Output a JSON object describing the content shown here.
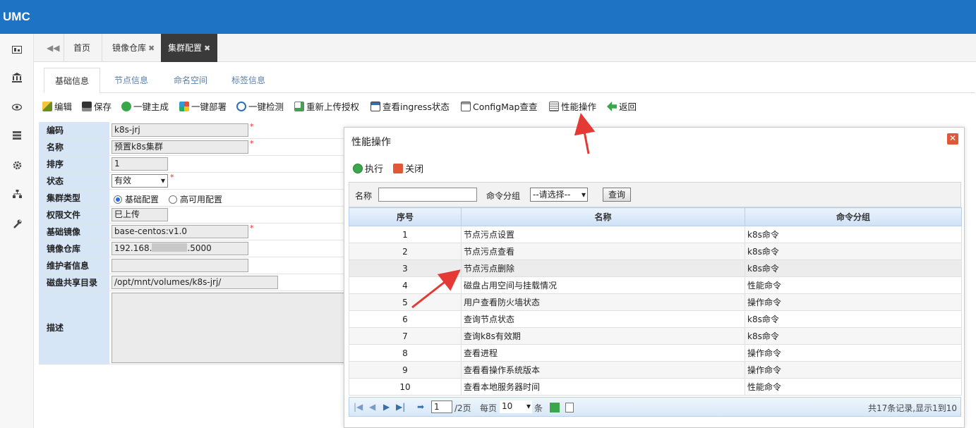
{
  "app": {
    "logo": "UMC"
  },
  "tabs": {
    "home": "首页",
    "image_repo": "镜像仓库",
    "cluster_config": "集群配置",
    "close_glyph": "✖"
  },
  "subtabs": [
    "基础信息",
    "节点信息",
    "命名空间",
    "标签信息"
  ],
  "toolbar": {
    "edit": "编辑",
    "save": "保存",
    "generate": "一键主成",
    "deploy": "一键部署",
    "check": "一键检测",
    "reupload": "重新上传授权",
    "ingress": "查看ingress状态",
    "configmap": "ConfigMap查查",
    "perf": "性能操作",
    "back": "返回"
  },
  "form": {
    "code_label": "编码",
    "code_value": "k8s-jrj",
    "name_label": "名称",
    "name_value": "预置k8s集群",
    "order_label": "排序",
    "order_value": "1",
    "status_label": "状态",
    "status_value": "有效",
    "type_label": "集群类型",
    "type_opt1": "基础配置",
    "type_opt2": "高可用配置",
    "perm_label": "权限文件",
    "perm_value": "巳上传",
    "base_image_label": "基础镜像",
    "base_image_value": "base-centos:v1.0",
    "repo_label": "镜像仓库",
    "repo_value_a": "192.168.",
    "repo_value_b": ".5000",
    "maint_label": "维护者信息",
    "maint_value": "",
    "disk_label": "磁盘共享目录",
    "disk_value": "/opt/mnt/volumes/k8s-jrj/",
    "desc_label": "描述",
    "required_mark": "*"
  },
  "dialog": {
    "title": "性能操作",
    "close": "✕",
    "execute": "执行",
    "close_btn": "关闭",
    "search": {
      "name_label": "名称",
      "name_value": "",
      "group_label": "命令分组",
      "group_value": "--请选择--",
      "query": "查询"
    },
    "columns": [
      "序号",
      "名称",
      "命令分组"
    ],
    "rows": [
      {
        "no": "1",
        "name": "节点污点设置",
        "group": "k8s命令"
      },
      {
        "no": "2",
        "name": "节点污点查看",
        "group": "k8s命令"
      },
      {
        "no": "3",
        "name": "节点污点删除",
        "group": "k8s命令"
      },
      {
        "no": "4",
        "name": "磁盘占用空间与挂载情况",
        "group": "性能命令"
      },
      {
        "no": "5",
        "name": "用户查看防火墙状态",
        "group": "操作命令"
      },
      {
        "no": "6",
        "name": "查询节点状态",
        "group": "k8s命令"
      },
      {
        "no": "7",
        "name": "查询k8s有效期",
        "group": "k8s命令"
      },
      {
        "no": "8",
        "name": "查看进程",
        "group": "操作命令"
      },
      {
        "no": "9",
        "name": "查看看操作系统版本",
        "group": "操作命令"
      },
      {
        "no": "10",
        "name": "查看本地服务器时间",
        "group": "性能命令"
      }
    ],
    "pager": {
      "page_value": "1",
      "total_pages": "/2页",
      "per_page_label": "每页",
      "per_page_value": "10",
      "unit": "条",
      "summary": "共17条记录,显示1到10"
    }
  },
  "colors": {
    "header": "#1e73c4",
    "label_bg": "#d7e6f7",
    "annotation_arrow": "#e53935"
  }
}
